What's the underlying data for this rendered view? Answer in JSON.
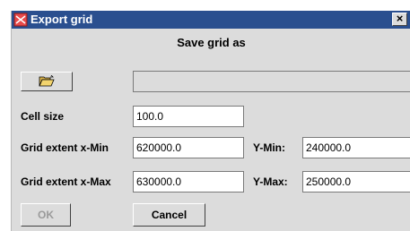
{
  "window": {
    "title": "Export grid",
    "close_label": "×",
    "heading": "Save grid as"
  },
  "file": {
    "path_value": ""
  },
  "fields": {
    "cell_size": {
      "label": "Cell size",
      "value": "100.0"
    },
    "x_min": {
      "label": "Grid extent x-Min",
      "value": "620000.0"
    },
    "y_min": {
      "label": "Y-Min:",
      "value": "240000.0"
    },
    "x_max": {
      "label": "Grid extent x-Max",
      "value": "630000.0"
    },
    "y_max": {
      "label": "Y-Max:",
      "value": "250000.0"
    }
  },
  "buttons": {
    "ok": "OK",
    "cancel": "Cancel",
    "browse_icon": "folder-open-icon"
  },
  "colors": {
    "titlebar": "#2a4f8f",
    "window_bg": "#dcdcdc"
  }
}
